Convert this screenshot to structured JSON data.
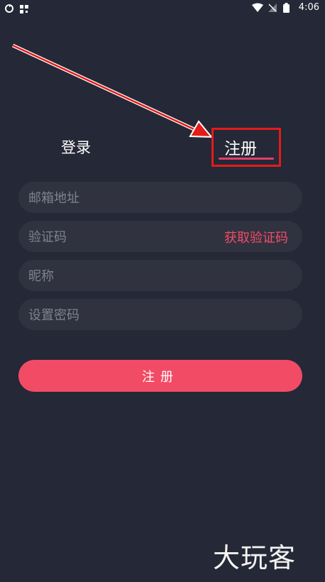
{
  "status_bar": {
    "time": "4:06",
    "icons": [
      "sync-icon",
      "qr-icon",
      "wifi-icon",
      "no-signal-icon",
      "battery-icon"
    ]
  },
  "tabs": {
    "login": "登录",
    "register": "注册",
    "active": "register"
  },
  "form": {
    "email_placeholder": "邮箱地址",
    "code_placeholder": "验证码",
    "get_code_label": "获取验证码",
    "nickname_placeholder": "昵称",
    "password_placeholder": "设置密码"
  },
  "submit_label": "注册",
  "watermark": "大玩客",
  "colors": {
    "background": "#252836",
    "field": "#30333f",
    "accent": "#f24b66",
    "annotation_red": "#e31b1b"
  }
}
